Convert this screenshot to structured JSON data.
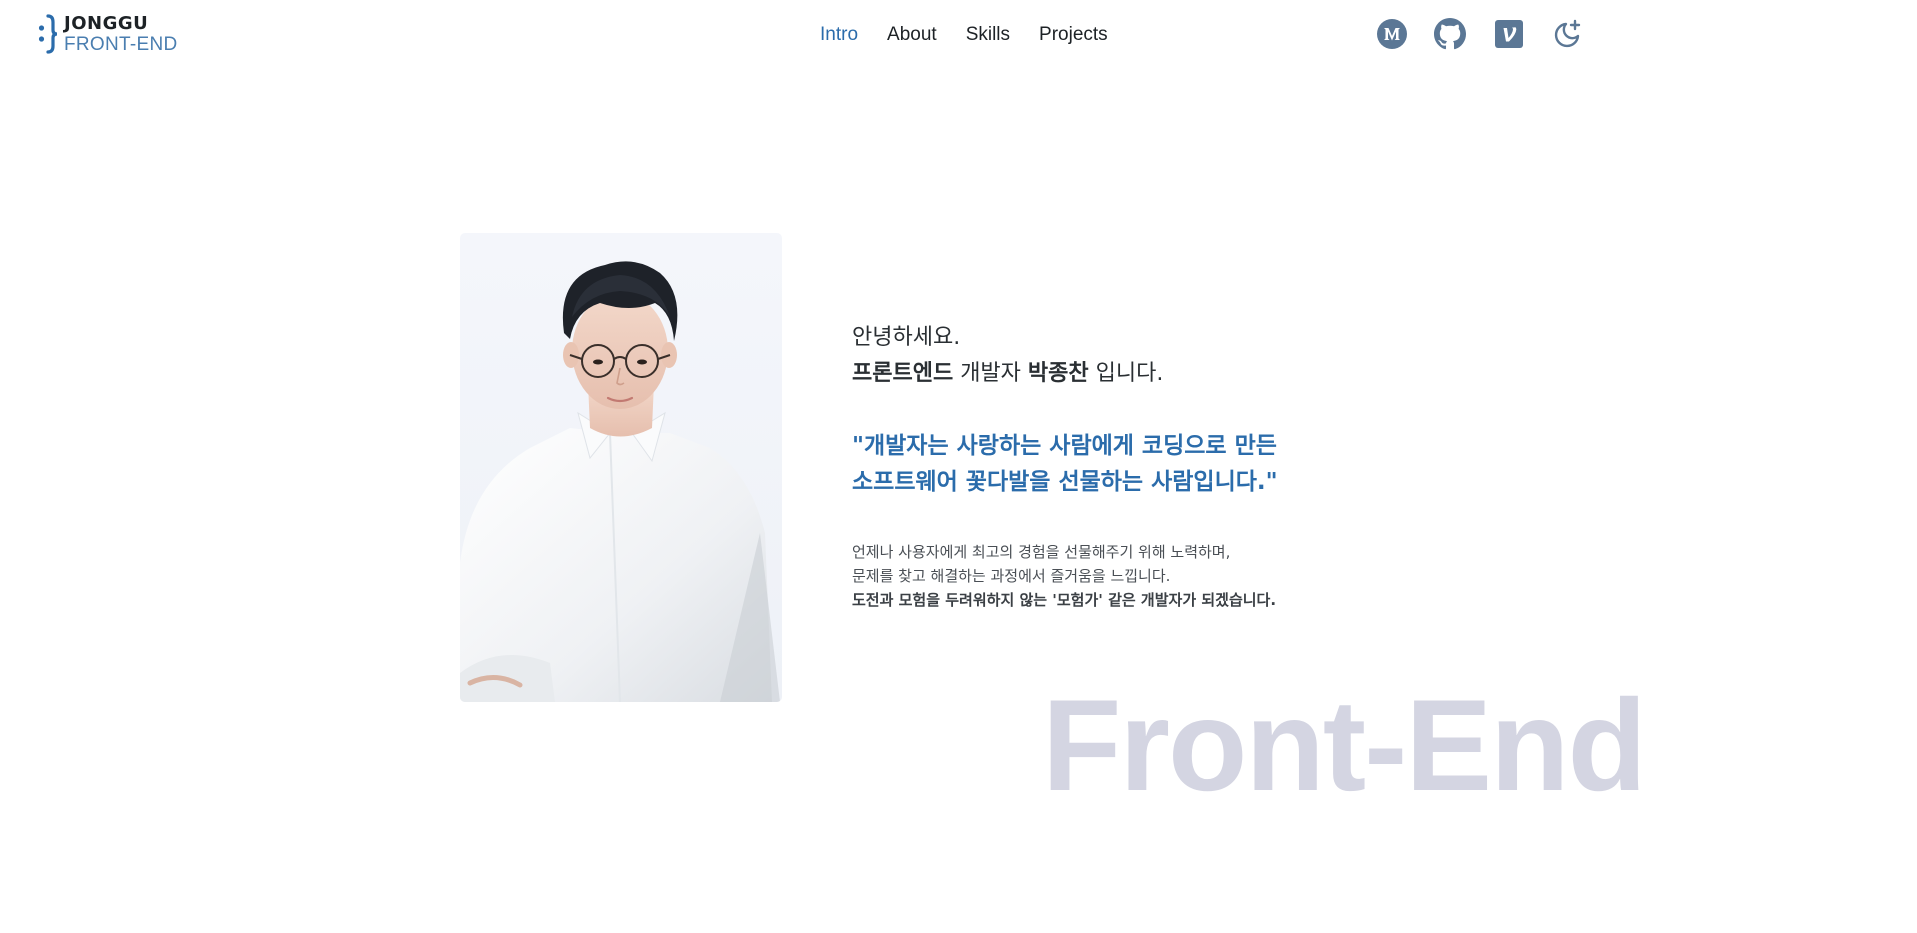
{
  "logo": {
    "title": "JONGGU",
    "subtitle": "FRONT-END",
    "accent": "#2b6cab"
  },
  "nav": {
    "items": [
      {
        "label": "Intro",
        "active": true
      },
      {
        "label": "About",
        "active": false
      },
      {
        "label": "Skills",
        "active": false
      },
      {
        "label": "Projects",
        "active": false
      }
    ],
    "active_color": "#2b6cab"
  },
  "social": {
    "icons": [
      "medium-icon",
      "github-icon",
      "velog-icon",
      "dark-mode-icon"
    ],
    "icon_color": "#5b7795"
  },
  "intro": {
    "greeting": "안녕하세요.",
    "role_highlight": "프론트엔드",
    "role_text": " 개발자 ",
    "name": "박종찬",
    "name_suffix": " 입니다.",
    "quote_line1": "\"개발자는 사랑하는 사람에게 코딩으로 만든",
    "quote_line2": "소프트웨어 꽃다발을 선물하는 사람입니다.\"",
    "desc_line1": "언제나 사용자에게 최고의 경험을 선물해주기 위해 노력하며,",
    "desc_line2": "문제를 찾고 해결하는 과정에서 즐거움을 느낍니다.",
    "desc_line3": "도전과 모험을 두려워하지 않는 '모험가' 같은 개발자가 되겠습니다."
  },
  "background_word": "Front-End"
}
